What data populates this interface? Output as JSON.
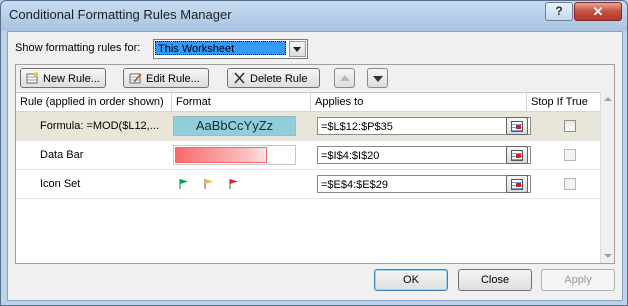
{
  "window": {
    "title": "Conditional Formatting Rules Manager",
    "help_label": "?",
    "close_label": "✕"
  },
  "show": {
    "label": "Show formatting rules for:",
    "selected": "This Worksheet"
  },
  "toolbar": {
    "new_rule": "New Rule...",
    "edit_rule": "Edit Rule...",
    "delete_rule": "Delete Rule"
  },
  "columns": {
    "rule": "Rule (applied in order shown)",
    "format": "Format",
    "applies_to": "Applies to",
    "stop_if_true": "Stop If True"
  },
  "rules": [
    {
      "rule": "Formula: =MOD($L12,...",
      "format_preview": "AaBbCcYyZz",
      "applies_to": "=$L$12:$P$35",
      "stop_if_true": false
    },
    {
      "rule": "Data Bar",
      "applies_to": "=$I$4:$I$20",
      "stop_if_true": false
    },
    {
      "rule": "Icon Set",
      "applies_to": "=$E$4:$E$29",
      "stop_if_true": false
    }
  ],
  "icon_set": [
    "green-flag-icon",
    "yellow-flag-icon",
    "red-flag-icon"
  ],
  "colors": {
    "format_preview_bg": "#92cddc",
    "databar_start": "#f8696b",
    "flag_green": "#00a650",
    "flag_yellow": "#ffb628",
    "flag_red": "#d8262d",
    "selected_row": "#e8e6d8"
  },
  "buttons": {
    "ok": "OK",
    "close": "Close",
    "apply": "Apply"
  }
}
